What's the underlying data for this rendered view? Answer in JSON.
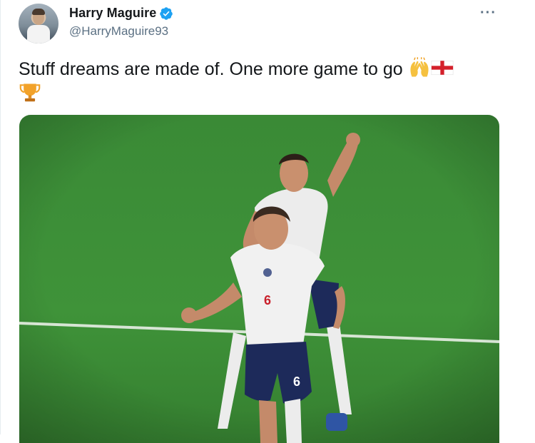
{
  "author": {
    "display_name": "Harry Maguire",
    "handle": "@HarryMaguire93",
    "verified": true
  },
  "tweet": {
    "text": "Stuff dreams are made of. One more game to go",
    "emojis": [
      "raising-hands",
      "england-flag",
      "trophy"
    ]
  },
  "menu": {
    "more_label": "···"
  },
  "media": {
    "kit_numbers": [
      "6",
      "6"
    ]
  },
  "colors": {
    "text_primary": "#14171a",
    "text_secondary": "#5b7083",
    "verified_blue": "#1da1f2",
    "pitch_green": "#3f8f3a"
  }
}
